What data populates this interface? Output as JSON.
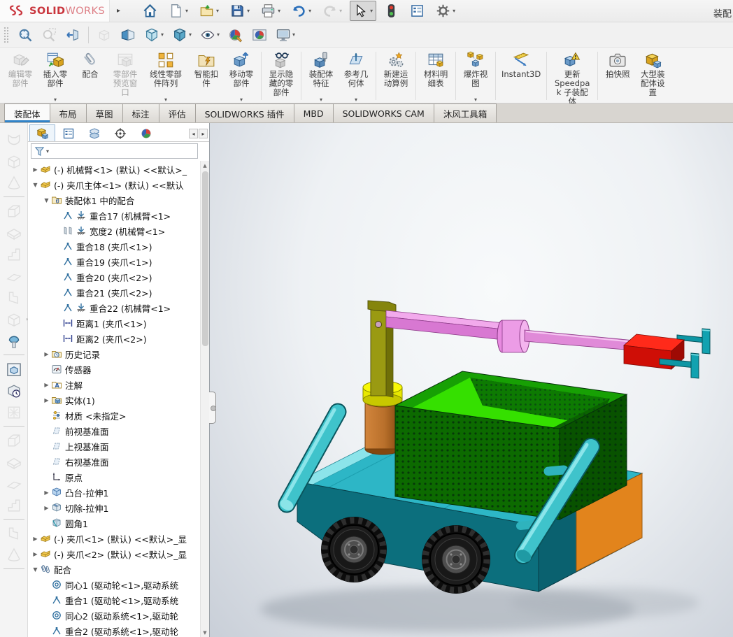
{
  "window": {
    "brand_bold": "SOLID",
    "brand_light": "WORKS",
    "doc_title": "装配"
  },
  "colors": {
    "accent_blue": "#3183c8",
    "brand_red": "#c9353d",
    "deck_cyan": "#2db6c6",
    "body_teal": "#0c6f7d",
    "orange": "#e2841c",
    "basket_green": "#0c6a00",
    "floor_green": "#35e000",
    "copper": "#b9702b",
    "ring_yellow": "#f6f600",
    "arm_olive": "#9a9a12",
    "boom_pink": "#e08ad8",
    "gripper_red": "#e01010",
    "tube_cyan": "#3fc3cb"
  },
  "toolbar_main": {
    "items": [
      {
        "name": "home-button",
        "icon": "home"
      },
      {
        "name": "new-document-button",
        "icon": "newdoc",
        "caret": true
      },
      {
        "name": "open-button",
        "icon": "open",
        "caret": true
      },
      {
        "name": "save-button",
        "icon": "save",
        "caret": true
      },
      {
        "name": "print-button",
        "icon": "print",
        "caret": true
      },
      {
        "name": "undo-button",
        "icon": "undo",
        "caret": true
      },
      {
        "name": "redo-button",
        "icon": "redo",
        "caret": true,
        "disabled": true
      },
      {
        "name": "select-tool-button",
        "icon": "cursor",
        "caret": true,
        "pressed": true
      },
      {
        "name": "rebuild-button",
        "icon": "rebuild"
      },
      {
        "name": "task-pane-button",
        "icon": "listpane"
      },
      {
        "name": "options-button",
        "icon": "gear",
        "caret": true
      }
    ]
  },
  "toolbar_view": {
    "items": [
      {
        "name": "zoom-to-fit-button",
        "icon": "zoomfit"
      },
      {
        "name": "zoom-to-area-button",
        "icon": "zoomarea",
        "disabled": true
      },
      {
        "name": "previous-view-button",
        "icon": "prevview"
      },
      {
        "type": "sep"
      },
      {
        "name": "3d-drawing-view-button",
        "icon": "drawview",
        "disabled": true
      },
      {
        "name": "section-view-button",
        "icon": "section"
      },
      {
        "name": "view-orientation-button",
        "icon": "viewcube",
        "caret": true
      },
      {
        "name": "display-style-button",
        "icon": "displaystyle",
        "caret": true
      },
      {
        "name": "hide-show-items-button",
        "icon": "eye",
        "caret": true
      },
      {
        "name": "edit-appearance-button",
        "icon": "appearance"
      },
      {
        "name": "apply-scene-button",
        "icon": "scene"
      },
      {
        "name": "view-settings-button",
        "icon": "monitor",
        "caret": true
      }
    ]
  },
  "ribbon": {
    "buttons": [
      {
        "name": "edit-component-button",
        "label": "编辑零部件",
        "icon": "editcomp",
        "disabled": true,
        "cls": "w3"
      },
      {
        "name": "insert-components-button",
        "label": "插入零部件",
        "icon": "insertcomp",
        "caret": true,
        "cls": "w3"
      },
      {
        "name": "mate-button",
        "label": "配合",
        "icon": "mate",
        "cls": "w3"
      },
      {
        "name": "component-preview-window-button",
        "label": "零部件预览窗口",
        "icon": "previewwin",
        "disabled": true,
        "cls": "w3"
      },
      {
        "name": "linear-component-pattern-button",
        "label": "线性零部件阵列",
        "icon": "linpattern",
        "caret": true,
        "cls": "w4"
      },
      {
        "name": "smart-fasteners-button",
        "label": "智能扣件",
        "icon": "smartfast",
        "cls": "w3"
      },
      {
        "name": "move-component-button",
        "label": "移动零部件",
        "icon": "movecomp",
        "caret": true,
        "cls": "w3"
      },
      {
        "type": "sep"
      },
      {
        "name": "show-hidden-components-button",
        "label": "显示隐藏的零部件",
        "icon": "showhidden",
        "cls": "w3"
      },
      {
        "type": "sep"
      },
      {
        "name": "assembly-features-button",
        "label": "装配体特征",
        "icon": "asmfeat",
        "caret": true,
        "cls": "w3"
      },
      {
        "name": "reference-geometry-button",
        "label": "参考几何体",
        "icon": "refgeom",
        "caret": true,
        "cls": "w3"
      },
      {
        "type": "sep"
      },
      {
        "name": "new-motion-study-button",
        "label": "新建运动算例",
        "icon": "motion",
        "cls": "w3"
      },
      {
        "type": "sep"
      },
      {
        "name": "bill-of-materials-button",
        "label": "材料明细表",
        "icon": "bom",
        "cls": "w3"
      },
      {
        "type": "sep"
      },
      {
        "name": "exploded-view-button",
        "label": "爆炸视图",
        "icon": "explview",
        "caret": true,
        "cls": "w3"
      },
      {
        "type": "sep"
      },
      {
        "name": "instant3d-button",
        "label": "Instant3D",
        "icon": "instant3d",
        "cls": "wa"
      },
      {
        "type": "sep"
      },
      {
        "name": "update-speedpak-button",
        "label": "更新 Speedpak 子装配体",
        "icon": "speedpak",
        "cls": "w4"
      },
      {
        "type": "sep"
      },
      {
        "name": "take-snapshot-button",
        "label": "拍快照",
        "icon": "snapshot",
        "cls": "w3"
      },
      {
        "name": "large-assembly-settings-button",
        "label": "大型装配体设置",
        "icon": "largeasm",
        "cls": "w3"
      }
    ]
  },
  "tabs": {
    "items": [
      {
        "name": "tab-assembly",
        "label": "装配体",
        "active": true
      },
      {
        "name": "tab-layout",
        "label": "布局"
      },
      {
        "name": "tab-sketch",
        "label": "草图"
      },
      {
        "name": "tab-markup",
        "label": "标注"
      },
      {
        "name": "tab-evaluate",
        "label": "评估"
      },
      {
        "name": "tab-solidworks-addins",
        "label": "SOLIDWORKS 插件"
      },
      {
        "name": "tab-mbd",
        "label": "MBD"
      },
      {
        "name": "tab-solidworks-cam",
        "label": "SOLIDWORKS CAM"
      },
      {
        "name": "tab-mufeng-toolbox",
        "label": "沐风工具箱"
      }
    ]
  },
  "headsup": {
    "items": [
      {
        "name": "zoom-to-fit-button",
        "icon": "zoomfit"
      },
      {
        "name": "zoom-to-area-button",
        "icon": "zoomarea"
      },
      {
        "name": "previous-view-button",
        "icon": "prevview"
      },
      {
        "name": "section-view-button",
        "icon": "section"
      },
      {
        "name": "edit-appearance-button",
        "icon": "appearance",
        "cls": "clipped"
      }
    ]
  },
  "panel": {
    "tabs": [
      {
        "name": "featuremanager-tab",
        "icon": "p_asm",
        "active": true
      },
      {
        "name": "propertymanager-tab",
        "icon": "listpane"
      },
      {
        "name": "configurationmanager-tab",
        "icon": "p_config"
      },
      {
        "name": "dimxpertmanager-tab",
        "icon": "p_target"
      },
      {
        "name": "displaymanager-tab",
        "icon": "p_ball"
      }
    ],
    "tree": [
      {
        "label": "(-) 机械臂<1> (默认) <<默认>_",
        "icon": "t_part",
        "depth": 0,
        "exp": ">"
      },
      {
        "label": "(-) 夹爪主体<1> (默认) <<默认",
        "icon": "t_part",
        "depth": 0,
        "exp": "v"
      },
      {
        "label": "装配体1 中的配合",
        "icon": "t_matefolder",
        "depth": 1,
        "exp": "v"
      },
      {
        "label": "重合17 (机械臂<1>",
        "icon": "t_coin",
        "depth": 2,
        "ground": true
      },
      {
        "label": "宽度2 (机械臂<1>",
        "icon": "t_width",
        "depth": 2,
        "ground": true
      },
      {
        "label": "重合18 (夹爪<1>)",
        "icon": "t_coin",
        "depth": 2
      },
      {
        "label": "重合19 (夹爪<1>)",
        "icon": "t_coin",
        "depth": 2
      },
      {
        "label": "重合20 (夹爪<2>)",
        "icon": "t_coin",
        "depth": 2
      },
      {
        "label": "重合21 (夹爪<2>)",
        "icon": "t_coin",
        "depth": 2
      },
      {
        "label": "重合22 (机械臂<1>",
        "icon": "t_coin",
        "depth": 2,
        "ground": true
      },
      {
        "label": "距离1 (夹爪<1>)",
        "icon": "t_dist",
        "depth": 2
      },
      {
        "label": "距离2 (夹爪<2>)",
        "icon": "t_dist",
        "depth": 2
      },
      {
        "label": "历史记录",
        "icon": "t_hist",
        "depth": 1,
        "exp": ">"
      },
      {
        "label": "传感器",
        "icon": "t_sensor",
        "depth": 1
      },
      {
        "label": "注解",
        "icon": "t_note",
        "depth": 1,
        "exp": ">"
      },
      {
        "label": "实体(1)",
        "icon": "t_solid",
        "depth": 1,
        "exp": ">"
      },
      {
        "label": "材质 <未指定>",
        "icon": "t_material",
        "depth": 1
      },
      {
        "label": "前视基准面",
        "icon": "t_plane",
        "depth": 1
      },
      {
        "label": "上视基准面",
        "icon": "t_plane",
        "depth": 1
      },
      {
        "label": "右视基准面",
        "icon": "t_plane",
        "depth": 1
      },
      {
        "label": "原点",
        "icon": "t_origin",
        "depth": 1
      },
      {
        "label": "凸台-拉伸1",
        "icon": "t_boss",
        "depth": 1,
        "exp": ">"
      },
      {
        "label": "切除-拉伸1",
        "icon": "t_cut",
        "depth": 1,
        "exp": ">"
      },
      {
        "label": "圆角1",
        "icon": "t_fillet",
        "depth": 1
      },
      {
        "label": "(-) 夹爪<1> (默认) <<默认>_显",
        "icon": "t_part",
        "depth": 0,
        "exp": ">"
      },
      {
        "label": "(-) 夹爪<2> (默认) <<默认>_显",
        "icon": "t_part",
        "depth": 0,
        "exp": ">"
      },
      {
        "label": "配合",
        "icon": "t_clip2",
        "depth": 0,
        "exp": "v"
      },
      {
        "label": "同心1 (驱动轮<1>,驱动系统",
        "icon": "t_conc",
        "depth": 1
      },
      {
        "label": "重合1 (驱动轮<1>,驱动系统",
        "icon": "t_coin",
        "depth": 1
      },
      {
        "label": "同心2 (驱动系统<1>,驱动轮",
        "icon": "t_conc",
        "depth": 1
      },
      {
        "label": "重合2 (驱动系统<1>,驱动轮",
        "icon": "t_coin",
        "depth": 1
      }
    ]
  },
  "left_toolbar": {
    "items": [
      {
        "icon": "lt1",
        "disabled": true
      },
      {
        "icon": "lt2",
        "disabled": true
      },
      {
        "icon": "lt3",
        "disabled": true
      },
      {
        "type": "sep"
      },
      {
        "icon": "lt4",
        "disabled": true
      },
      {
        "icon": "lt5",
        "disabled": true
      },
      {
        "icon": "lt6",
        "disabled": true
      },
      {
        "icon": "lt7",
        "disabled": true
      },
      {
        "icon": "lt8",
        "disabled": true
      },
      {
        "icon": "lt2",
        "disabled": true,
        "caret": true
      },
      {
        "icon": "lt_rivet"
      },
      {
        "type": "sep"
      },
      {
        "icon": "lt_frame"
      },
      {
        "icon": "lt_clock"
      },
      {
        "icon": "lt_grid",
        "disabled": true
      },
      {
        "type": "sep"
      },
      {
        "icon": "lt4",
        "disabled": true
      },
      {
        "icon": "lt5",
        "disabled": true
      },
      {
        "icon": "lt7",
        "disabled": true
      },
      {
        "icon": "lt6",
        "disabled": true
      },
      {
        "type": "sep"
      },
      {
        "icon": "lt8",
        "disabled": true
      },
      {
        "icon": "lt3",
        "disabled": true
      },
      {
        "type": "sep"
      }
    ]
  },
  "viewport": {
    "model": "robot-cart-with-gripper-arm-assembly"
  }
}
